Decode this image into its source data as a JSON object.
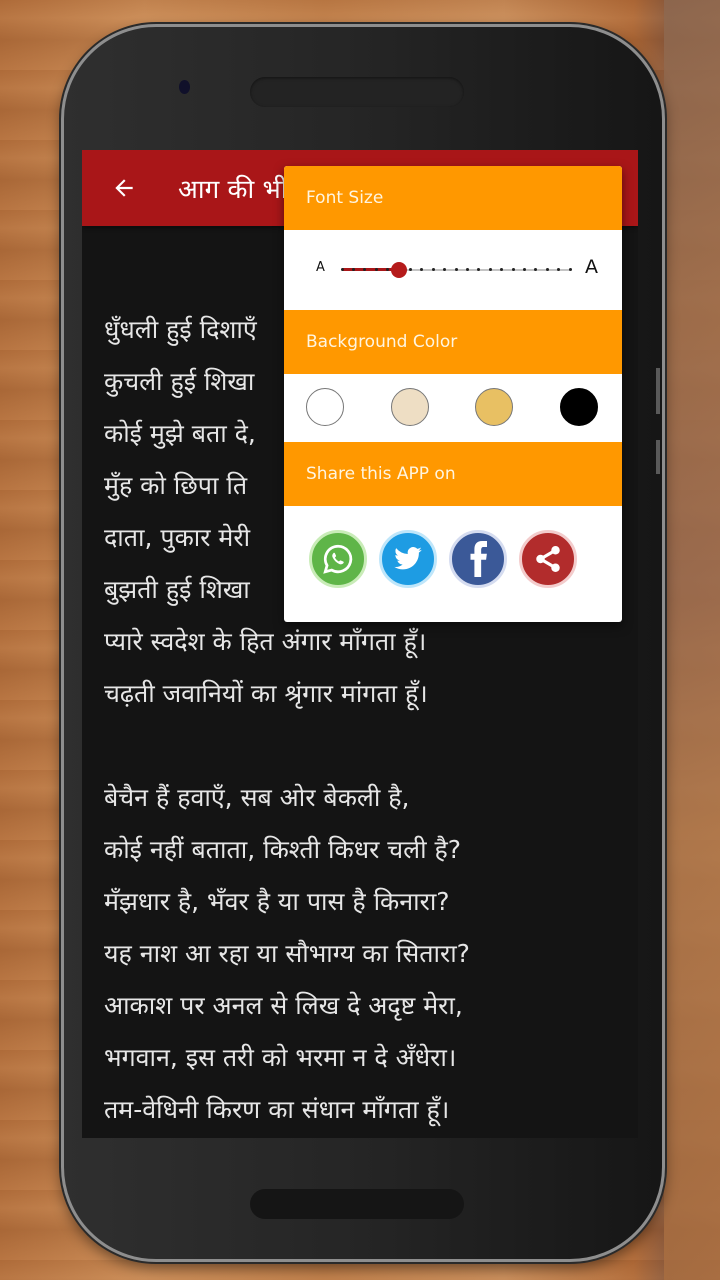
{
  "app": {
    "title": "आग की भीख",
    "title_visible": "आग की भ"
  },
  "poem": {
    "lines": [
      "धुँधली हुई दिशाएँ",
      "कुचली हुई शिखा",
      "कोई मुझे बता दे,",
      "मुँह को छिपा ति",
      "दाता, पुकार मेरी",
      "बुझती हुई शिखा",
      "प्यारे स्वदेश के हित अंगार माँगता हूँ।",
      "चढ़ती जवानियों का श्रृंगार मांगता हूँ।",
      "",
      "बेचैन हैं हवाएँ, सब ओर बेकली है,",
      "कोई नहीं बताता, किश्ती किधर चली है?",
      "मँझधार है, भँवर है या पास है किनारा?",
      "यह नाश आ रहा या सौभाग्य का सितारा?",
      "आकाश पर अनल से लिख दे अदृष्ट मेरा,",
      "भगवान, इस तरी को भरमा न दे अँधेरा।",
      "तम-वेधिनी किरण का संधान माँगता हूँ।"
    ]
  },
  "settings_panel": {
    "font_size": {
      "header": "Font Size",
      "small_label": "A",
      "large_label": "A",
      "steps": 20,
      "value_step": 5,
      "value_fraction": 0.25
    },
    "background_color": {
      "header": "Background Color",
      "options": [
        {
          "name": "white",
          "color": "#ffffff"
        },
        {
          "name": "cream",
          "color": "#eedec4"
        },
        {
          "name": "golden",
          "color": "#e8c063"
        },
        {
          "name": "black",
          "color": "#000000"
        }
      ]
    },
    "share": {
      "header": "Share this APP on",
      "targets": [
        {
          "name": "whatsapp",
          "icon": "whatsapp-icon",
          "color": "#5fb548"
        },
        {
          "name": "twitter",
          "icon": "twitter-icon",
          "color": "#1e9ce3"
        },
        {
          "name": "facebook",
          "icon": "facebook-icon",
          "color": "#3b5998"
        },
        {
          "name": "share",
          "icon": "share-icon",
          "color": "#b22c2c"
        }
      ]
    }
  },
  "colors": {
    "appbar": "#a91618",
    "panel_header": "#ff9800",
    "reader_bg": "#141414",
    "reader_text": "#e6e6e6"
  }
}
